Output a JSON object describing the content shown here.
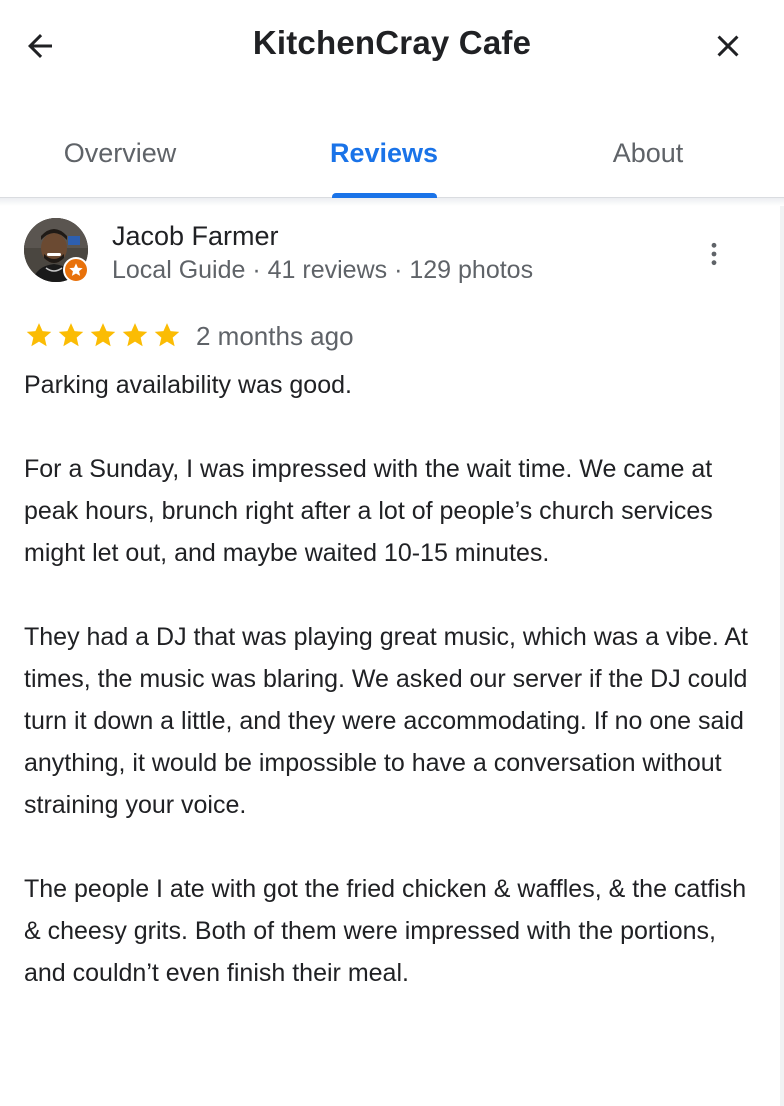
{
  "header": {
    "title": "KitchenCray Cafe",
    "back_icon": "arrow-left-icon",
    "close_icon": "close-icon"
  },
  "tabs": [
    {
      "label": "Overview",
      "active": false
    },
    {
      "label": "Reviews",
      "active": true
    },
    {
      "label": "About",
      "active": false
    }
  ],
  "review": {
    "reviewer": {
      "name": "Jacob Farmer",
      "meta": "Local Guide · 41 reviews · 129 photos",
      "badge_icon": "local-guide-star-icon"
    },
    "rating": 5,
    "date": "2 months ago",
    "paragraphs": [
      "Parking availability was good.",
      "For a Sunday, I was impressed with the wait time. We came at peak hours, brunch right after a lot of people’s church services might let out, and maybe waited 10-15 minutes.",
      "They had a DJ that was playing great music, which was a vibe. At times, the music was blaring. We asked our server if the DJ could turn it down a little, and they were accommodating. If no one said anything, it would be impossible to have a conversation without straining your voice.",
      "The people I ate with got the fried chicken & waffles, & the catfish & cheesy grits. Both of them were impressed with the portions, and couldn’t even finish their meal."
    ]
  },
  "colors": {
    "accent": "#1a73e8",
    "star": "#fbbc04",
    "badge": "#e8710a",
    "secondary_text": "#5f6368"
  }
}
